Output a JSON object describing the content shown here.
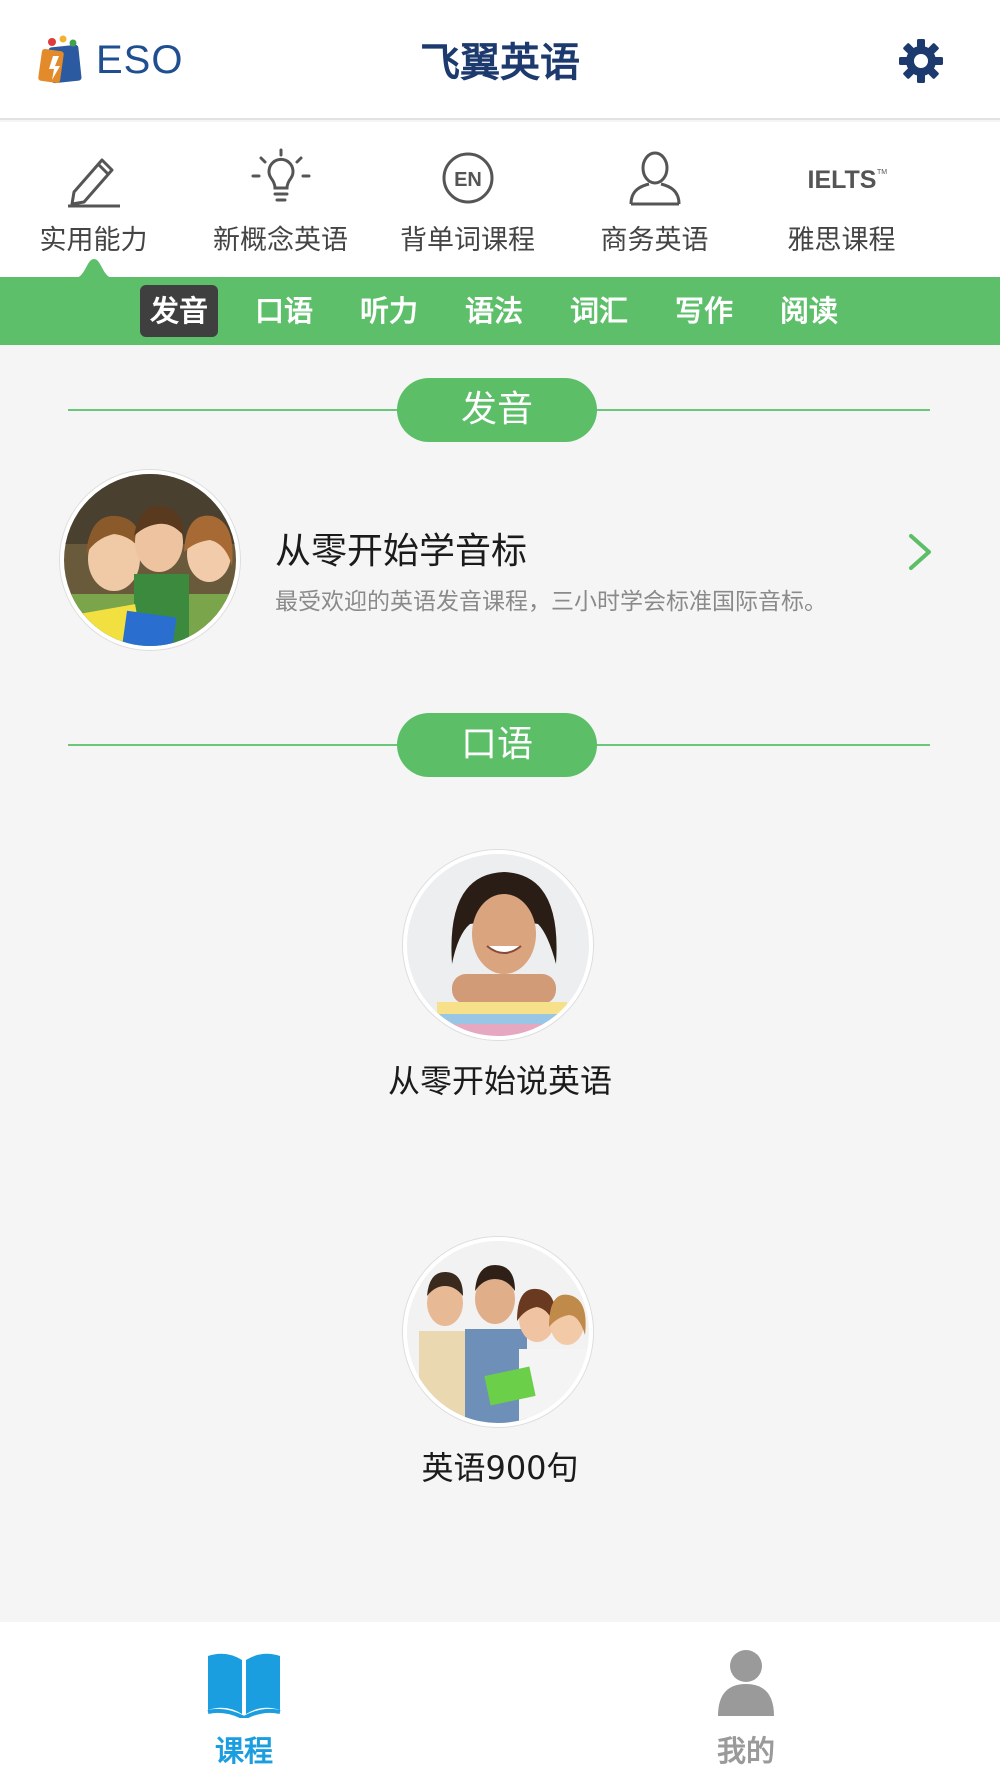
{
  "header": {
    "logo_text": "ESO",
    "title": "飞翼英语",
    "settings_icon": "gear-icon",
    "title_color": "#1d3a6e"
  },
  "categories": [
    {
      "label": "实用能力",
      "icon": "pencil-icon"
    },
    {
      "label": "新概念英语",
      "icon": "lightbulb-icon"
    },
    {
      "label": "背单词课程",
      "icon": "en-badge-icon"
    },
    {
      "label": "商务英语",
      "icon": "user-outline-icon"
    },
    {
      "label": "雅思课程",
      "icon": "ielts-logo-icon",
      "icon_text": "IELTS"
    }
  ],
  "tabs": [
    {
      "label": "发音",
      "active": true
    },
    {
      "label": "口语",
      "active": false
    },
    {
      "label": "听力",
      "active": false
    },
    {
      "label": "语法",
      "active": false
    },
    {
      "label": "词汇",
      "active": false
    },
    {
      "label": "写作",
      "active": false
    },
    {
      "label": "阅读",
      "active": false
    }
  ],
  "sections": [
    {
      "title": "发音",
      "courses": [
        {
          "title": "从零开始学音标",
          "description": "最受欢迎的英语发音课程，三小时学会标准国际音标。",
          "image": "students-group-photo"
        }
      ]
    },
    {
      "title": "口语",
      "courses": [
        {
          "title": "从零开始说英语",
          "image": "smiling-woman-with-books-photo"
        },
        {
          "title": "英语900句",
          "image": "young-adults-group-photo"
        }
      ]
    }
  ],
  "bottom_nav": [
    {
      "label": "课程",
      "icon": "open-book-icon",
      "active": true
    },
    {
      "label": "我的",
      "icon": "person-icon",
      "active": false
    }
  ],
  "colors": {
    "green": "#5dbf6a",
    "active_tab": "#3f3f3f",
    "nav_active": "#1a9ee0",
    "nav_inactive": "#9a9a9a"
  }
}
